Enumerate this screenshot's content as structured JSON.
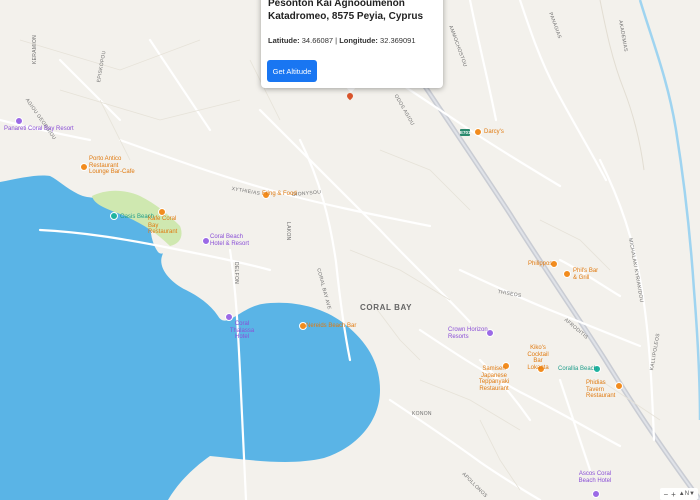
{
  "popup": {
    "title": "Pesonton Kai Agnooumenon Katadromeo, 8575 Peyia, Cyprus",
    "latitude_label": "Latitude:",
    "latitude_value": "34.66087",
    "separator": " | ",
    "longitude_label": "Longitude:",
    "longitude_value": "32.369091",
    "button_label": "Get Altitude"
  },
  "road_shield": "E701",
  "area_label": "CORAL BAY",
  "pois": {
    "panareti": "Panareti Coral Bay Resort",
    "porto_antico": "Porto Antico Restaurant Lounge Bar-Cafe",
    "oasis": "Oasis Beach",
    "kafe_coral": "Kafe Coral Bay Restaurant",
    "coral_beach_hotel": "Coral Beach Hotel & Resort",
    "fring": "Fring & Food",
    "darcys": "Darcy's",
    "philippos": "Philippos",
    "phils": "Phil's Bar & Grill",
    "coral_thalassa": "Coral Thalassa Hotel",
    "nereids": "Nereids Beach Bar",
    "crown_horizon": "Crown Horizon Resorts",
    "kikos": "Kiko's Cocktail Bar Lokanta",
    "samisen": "Samisen Japanese Teppanyaki Restaurant",
    "corallia": "Corallia Beach",
    "phidias": "Phidias Tavern Restaurant",
    "ascos": "Ascos Coral Beach Hotel"
  },
  "streets": {
    "s1": "KERAMION",
    "s2": "EPISKOPOU",
    "s3": "AGIOU GEORGIOU",
    "s4": "AMMOCHOSTOU",
    "s5": "ODOS AGIOU",
    "s6": "XYTHIEIAS",
    "s7": "DIONYSOU",
    "s8": "LAKON",
    "s9": "CORAL BAY AVE",
    "s10": "MICHALAKI KYRIAKIDOU",
    "s11": "PANAGIAS",
    "s12": "AKADEMIAS",
    "s13": "THISEOS",
    "s14": "AFRODITIS",
    "s15": "KONON",
    "s16": "APOLLONOS",
    "s17": "DELFON",
    "s18": "KALLIPOLEOS"
  },
  "controls": {
    "minus": "−",
    "plus": "+",
    "compass": "▲N▼"
  },
  "colors": {
    "land": "#f3f1ec",
    "water": "#5ab4e6",
    "highway": "#c9ccd3",
    "button": "#1976f2",
    "green": "#cfe8b0"
  }
}
